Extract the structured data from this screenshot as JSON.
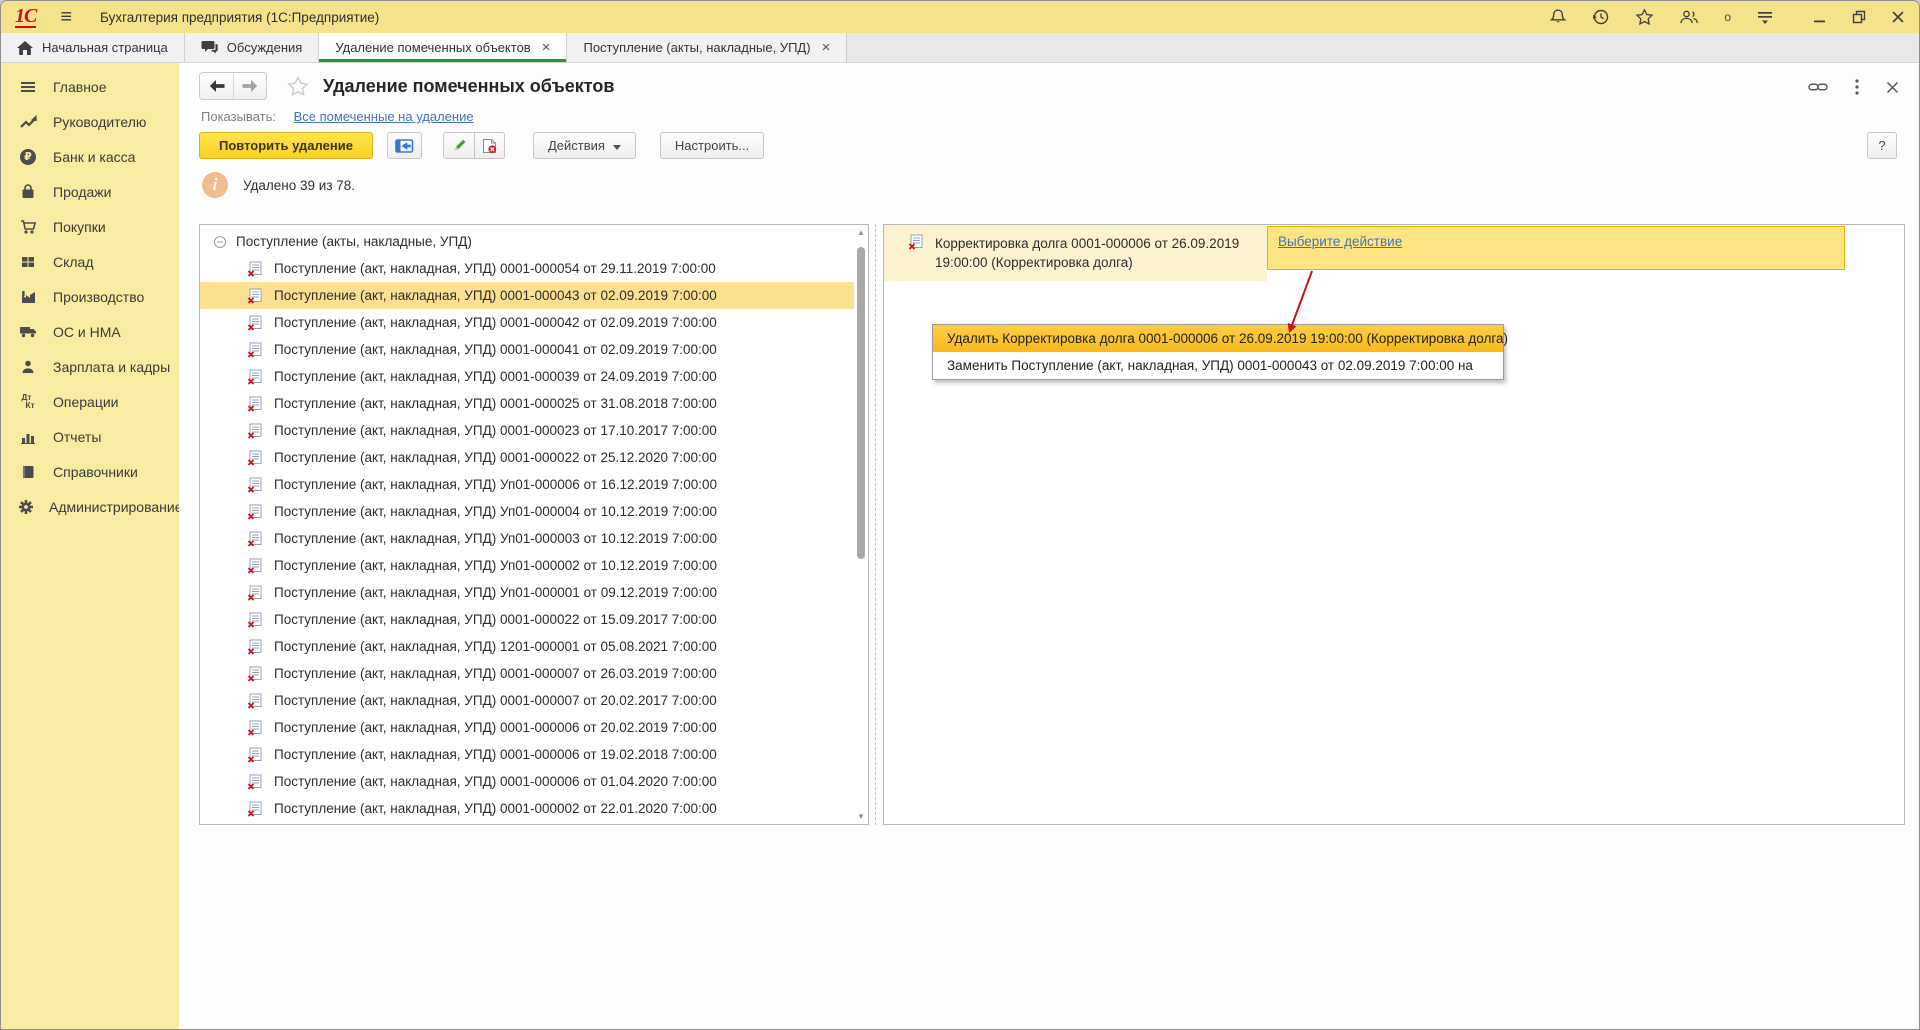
{
  "colors": {
    "titlebar_yellow": "#f5e38b",
    "sidebar_yellow": "#f8eca3",
    "active_tab_green": "#23963c",
    "selection_yellow": "#fbe091",
    "action_box_fill": "#ffe582",
    "action_box_border": "#edaf00",
    "menu_highlight": "#f8ba1a",
    "primary_button_yellow": "#fbd224",
    "link_blue": "#4272b8",
    "annotation_arrow_red": "#c81414",
    "marked_x_red": "#c61420"
  },
  "titlebar": {
    "app_title": "Бухгалтерия предприятия  (1С:Предприятие)",
    "logo": "1С",
    "online_indicator": "o"
  },
  "tabs": [
    {
      "icon": "home",
      "label": "Начальная страница",
      "closable": false,
      "active": false
    },
    {
      "icon": "chat",
      "label": "Обсуждения",
      "closable": false,
      "active": false
    },
    {
      "icon": null,
      "label": "Удаление помеченных объектов",
      "closable": true,
      "active": true
    },
    {
      "icon": null,
      "label": "Поступление (акты, накладные, УПД)",
      "closable": true,
      "active": false
    }
  ],
  "sidebar": {
    "items": [
      {
        "icon": "menu",
        "label": "Главное"
      },
      {
        "icon": "trend",
        "label": "Руководителю"
      },
      {
        "icon": "ruble",
        "label": "Банк и касса"
      },
      {
        "icon": "bag",
        "label": "Продажи"
      },
      {
        "icon": "cart",
        "label": "Покупки"
      },
      {
        "icon": "grid",
        "label": "Склад"
      },
      {
        "icon": "factory",
        "label": "Производство"
      },
      {
        "icon": "truck",
        "label": "ОС и НМА"
      },
      {
        "icon": "person",
        "label": "Зарплата и кадры"
      },
      {
        "icon": "dtkt",
        "label": "Операции"
      },
      {
        "icon": "chart",
        "label": "Отчеты"
      },
      {
        "icon": "book",
        "label": "Справочники"
      },
      {
        "icon": "gear",
        "label": "Администрирование"
      }
    ]
  },
  "page": {
    "title": "Удаление помеченных объектов",
    "show_label": "Показывать:",
    "show_link": "Все помеченные на удаление",
    "toolbar": {
      "repeat_delete": "Повторить удаление",
      "actions": "Действия",
      "configure": "Настроить...",
      "help": "?"
    },
    "info": "Удалено 39 из 78."
  },
  "left_list": {
    "group": "Поступление (акты, накладные, УПД)",
    "selected_index": 1,
    "items": [
      "Поступление (акт, накладная, УПД) 0001-000054 от 29.11.2019 7:00:00",
      "Поступление (акт, накладная, УПД) 0001-000043 от 02.09.2019 7:00:00",
      "Поступление (акт, накладная, УПД) 0001-000042 от 02.09.2019 7:00:00",
      "Поступление (акт, накладная, УПД) 0001-000041 от 02.09.2019 7:00:00",
      "Поступление (акт, накладная, УПД) 0001-000039 от 24.09.2019 7:00:00",
      "Поступление (акт, накладная, УПД) 0001-000025 от 31.08.2018 7:00:00",
      "Поступление (акт, накладная, УПД) 0001-000023 от 17.10.2017 7:00:00",
      "Поступление (акт, накладная, УПД) 0001-000022 от 25.12.2020 7:00:00",
      "Поступление (акт, накладная, УПД) Уп01-000006 от 16.12.2019 7:00:00",
      "Поступление (акт, накладная, УПД) Уп01-000004 от 10.12.2019 7:00:00",
      "Поступление (акт, накладная, УПД) Уп01-000003 от 10.12.2019 7:00:00",
      "Поступление (акт, накладная, УПД) Уп01-000002 от 10.12.2019 7:00:00",
      "Поступление (акт, накладная, УПД) Уп01-000001 от 09.12.2019 7:00:00",
      "Поступление (акт, накладная, УПД) 0001-000022 от 15.09.2017 7:00:00",
      "Поступление (акт, накладная, УПД) 1201-000001 от 05.08.2021 7:00:00",
      "Поступление (акт, накладная, УПД) 0001-000007 от 26.03.2019 7:00:00",
      "Поступление (акт, накладная, УПД) 0001-000007 от 20.02.2017 7:00:00",
      "Поступление (акт, накладная, УПД) 0001-000006 от 20.02.2019 7:00:00",
      "Поступление (акт, накладная, УПД) 0001-000006 от 19.02.2018 7:00:00",
      "Поступление (акт, накладная, УПД) 0001-000006 от 01.04.2020 7:00:00",
      "Поступление (акт, накладная, УПД) 0001-000002 от 22.01.2020 7:00:00"
    ]
  },
  "right_panel": {
    "item_line1": "Корректировка долга 0001-000006 от 26.09.2019",
    "item_line2": "19:00:00 (Корректировка долга)",
    "action_link": "Выберите действие",
    "menu": [
      {
        "label": "Удалить Корректировка долга 0001-000006 от 26.09.2019 19:00:00 (Корректировка долга)",
        "highlighted": true
      },
      {
        "label": "Заменить Поступление (акт, накладная, УПД) 0001-000043 от 02.09.2019 7:00:00 на",
        "highlighted": false
      }
    ]
  }
}
